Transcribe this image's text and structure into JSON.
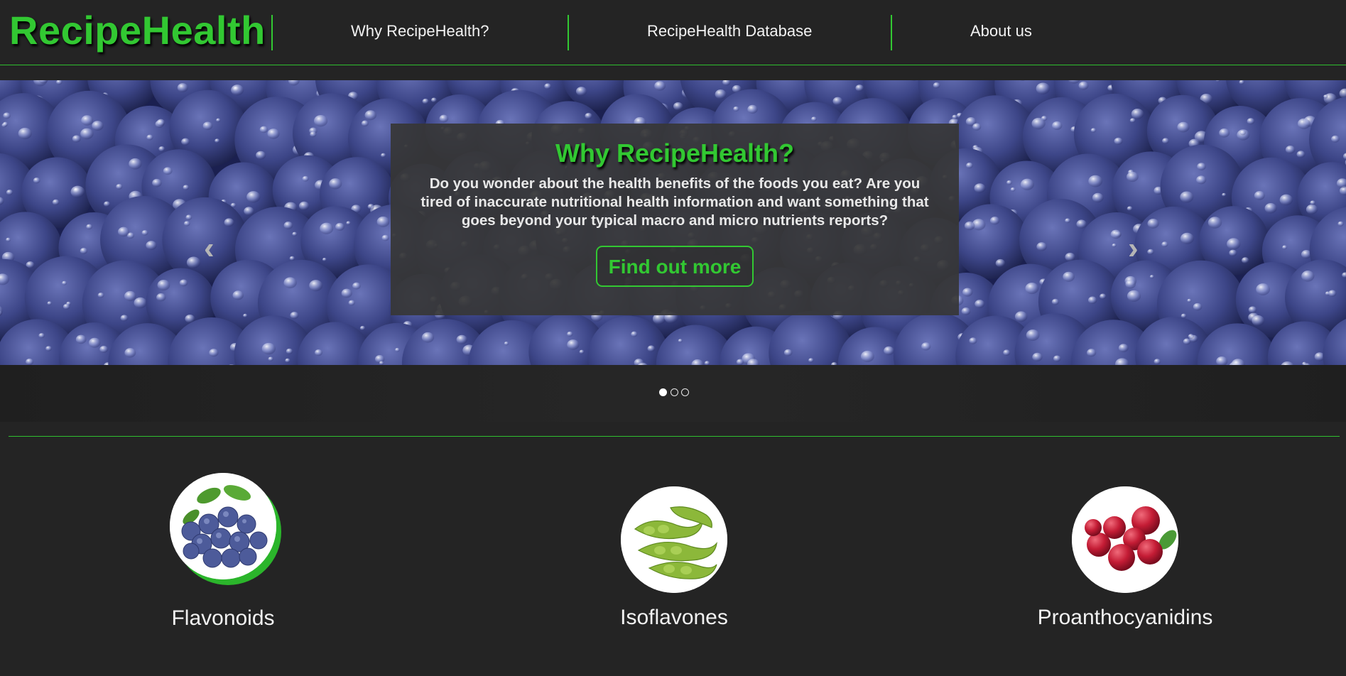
{
  "brand": "RecipeHealth",
  "nav": {
    "links": [
      {
        "label": "Why RecipeHealth?"
      },
      {
        "label": "RecipeHealth Database"
      },
      {
        "label": "About us"
      }
    ]
  },
  "carousel": {
    "title": "Why RecipeHealth?",
    "text": "Do you wonder about the health benefits of the foods you eat? Are you tired of inaccurate nutritional health information and want something that goes beyond your typical macro and micro nutrients reports?",
    "button_label": "Find out more",
    "prev_icon": "chevron-left-icon",
    "next_icon": "chevron-right-icon",
    "slide_count": 3,
    "active_slide": 1
  },
  "features": [
    {
      "label": "Flavonoids",
      "image": "blueberries"
    },
    {
      "label": "Isoflavones",
      "image": "edamame"
    },
    {
      "label": "Proanthocyanidins",
      "image": "cranberries"
    }
  ],
  "colors": {
    "accent": "#32c832",
    "background": "#242424"
  }
}
